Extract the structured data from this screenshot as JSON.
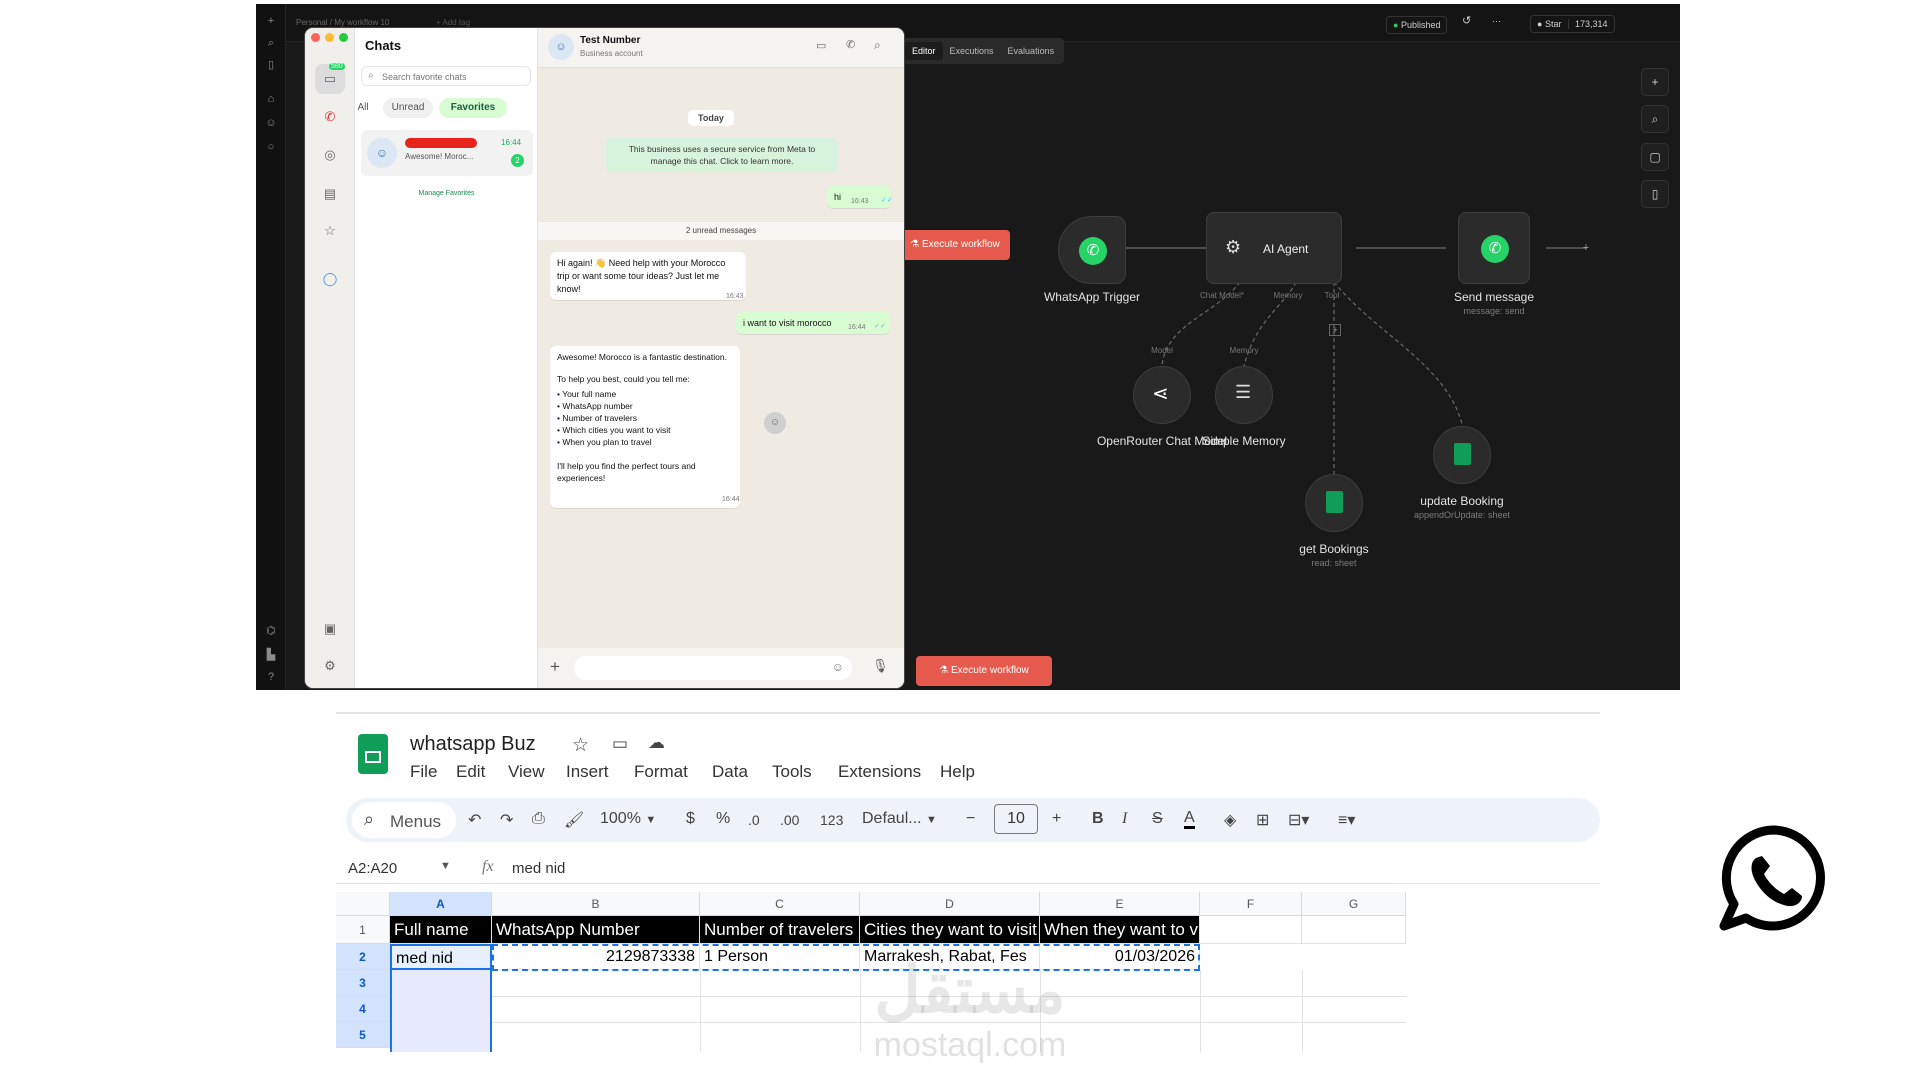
{
  "n8n": {
    "breadcrumb": "Personal  /  My workflow 10",
    "add_tag": "+ Add tag",
    "published": "Published",
    "star_label": "Star",
    "star_count": "173,314",
    "tabs": [
      "Editor",
      "Executions",
      "Evaluations"
    ],
    "execute_label": "Execute workflow",
    "nodes": {
      "trigger": {
        "label": "WhatsApp Trigger"
      },
      "agent": {
        "label": "AI Agent",
        "ports": [
          "Chat Model*",
          "Memory",
          "Tool"
        ]
      },
      "send": {
        "label": "Send message",
        "sub": "message: send"
      },
      "openrouter": {
        "label": "OpenRouter Chat Model",
        "port": "Model"
      },
      "memory": {
        "label": "Simple Memory",
        "port": "Memory"
      },
      "get": {
        "label": "get Bookings",
        "sub": "read: sheet"
      },
      "update": {
        "label": "update Booking",
        "sub": "appendOrUpdate: sheet"
      }
    }
  },
  "whatsapp": {
    "badge": "580",
    "list_title": "Chats",
    "search_placeholder": "Search favorite chats",
    "filters": [
      "All",
      "Unread",
      "Favorites"
    ],
    "chat_item": {
      "preview": "Awesome! Moroc...",
      "time": "16:44",
      "unread": "2"
    },
    "manage": "Manage Favorites",
    "contact_name": "Test Number",
    "contact_sub": "Business account",
    "day": "Today",
    "meta_notice": "This business uses a secure service from Meta to manage this chat. Click to learn more.",
    "unread_divider": "2 unread messages",
    "messages": [
      {
        "dir": "out",
        "text": "hi",
        "time": "16:43"
      },
      {
        "dir": "in",
        "text": "Hi again! 👋 Need help with your Morocco trip or want some tour ideas? Just let me know!",
        "time": "16:43"
      },
      {
        "dir": "out",
        "text": "i want to visit morocco",
        "time": "16:44"
      }
    ],
    "long_msg": {
      "intro": "Awesome! Morocco is a fantastic destination.",
      "ask": "To help you best, could you tell me:",
      "items": [
        "Your full name",
        "WhatsApp number",
        "Number of travelers",
        "Which cities you want to visit",
        "When you plan to travel"
      ],
      "outro": "I'll help you find the perfect tours and experiences!",
      "time": "16:44"
    }
  },
  "sheets": {
    "title": "whatsapp Buz",
    "menus": [
      "File",
      "Edit",
      "View",
      "Insert",
      "Format",
      "Data",
      "Tools",
      "Extensions",
      "Help"
    ],
    "toolbar": {
      "menus_label": "Menus",
      "zoom": "100%",
      "currency": "$",
      "percent": "%",
      "dec_minus": ".0",
      "dec_plus": ".00",
      "num_format": "123",
      "font": "Defaul...",
      "font_size": "10"
    },
    "name_box": "A2:A20",
    "formula_value": "med nid",
    "columns": [
      "A",
      "B",
      "C",
      "D",
      "E",
      "F",
      "G"
    ],
    "rows": [
      "1",
      "2",
      "3",
      "4",
      "5"
    ],
    "headers": [
      "Full name",
      "WhatsApp Number",
      "Number of travelers",
      "Cities they want to visit",
      "When they want to visit"
    ],
    "row2": [
      "med nid",
      "2129873338",
      "1 Person",
      "Marrakesh, Rabat, Fes",
      "01/03/2026"
    ]
  },
  "watermark": {
    "arabic": "مستقل",
    "latin": "mostaql.com"
  },
  "colors": {
    "whatsapp_green": "#25D366",
    "n8n_accent": "#e65a4d",
    "sheets_green": "#0f9d58"
  }
}
